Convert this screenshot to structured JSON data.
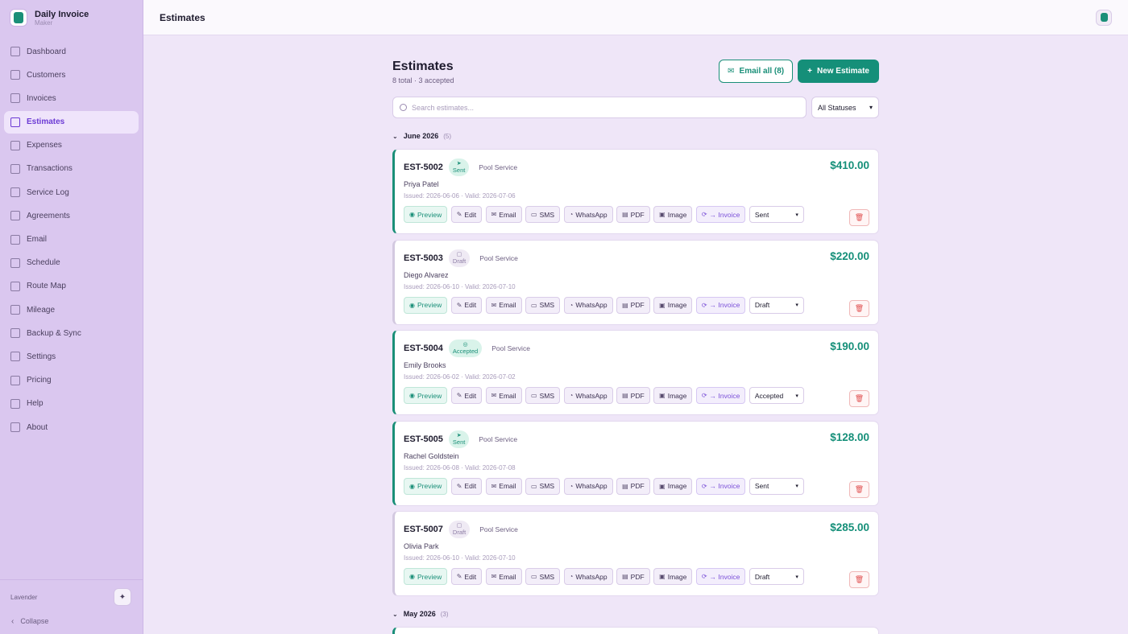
{
  "brand": {
    "title": "Daily Invoice",
    "subtitle": "Maker"
  },
  "sidebar": {
    "items": [
      {
        "label": "Dashboard",
        "icon": "dashboard-icon",
        "active": false
      },
      {
        "label": "Customers",
        "icon": "users-icon",
        "active": false
      },
      {
        "label": "Invoices",
        "icon": "invoice-icon",
        "active": false
      },
      {
        "label": "Estimates",
        "icon": "estimate-icon",
        "active": true
      },
      {
        "label": "Expenses",
        "icon": "receipt-icon",
        "active": false
      },
      {
        "label": "Transactions",
        "icon": "card-icon",
        "active": false
      },
      {
        "label": "Service Log",
        "icon": "clipboard-icon",
        "active": false
      },
      {
        "label": "Agreements",
        "icon": "document-edit-icon",
        "active": false
      },
      {
        "label": "Email",
        "icon": "mail-icon",
        "active": false
      },
      {
        "label": "Schedule",
        "icon": "calendar-icon",
        "active": false
      },
      {
        "label": "Route Map",
        "icon": "map-icon",
        "active": false
      },
      {
        "label": "Mileage",
        "icon": "pin-icon",
        "active": false
      },
      {
        "label": "Backup & Sync",
        "icon": "cloud-icon",
        "active": false
      },
      {
        "label": "Settings",
        "icon": "gear-icon",
        "active": false
      },
      {
        "label": "Pricing",
        "icon": "crown-icon",
        "active": false
      },
      {
        "label": "Help",
        "icon": "book-icon",
        "active": false
      },
      {
        "label": "About",
        "icon": "info-icon",
        "active": false
      }
    ],
    "theme_label": "Lavender",
    "collapse_label": "Collapse"
  },
  "header": {
    "title": "Estimates"
  },
  "page": {
    "title": "Estimates",
    "subtitle": "8 total · 3 accepted",
    "email_all_label": "Email all (8)",
    "new_estimate_label": "New Estimate",
    "search_placeholder": "Search estimates...",
    "status_filter": "All Statuses"
  },
  "action_labels": {
    "preview": "Preview",
    "edit": "Edit",
    "email": "Email",
    "sms": "SMS",
    "whatsapp": "WhatsApp",
    "pdf": "PDF",
    "image": "Image",
    "invoice": "→ Invoice"
  },
  "groups": [
    {
      "label": "June 2026",
      "count": "(5)",
      "estimates": [
        {
          "number": "EST-5002",
          "status": "Sent",
          "service": "Pool Service",
          "customer": "Priya Patel",
          "dates": "Issued: 2026-06-06 · Valid: 2026-07-06",
          "amount": "$410.00",
          "select": "Sent"
        },
        {
          "number": "EST-5003",
          "status": "Draft",
          "service": "Pool Service",
          "customer": "Diego Alvarez",
          "dates": "Issued: 2026-06-10 · Valid: 2026-07-10",
          "amount": "$220.00",
          "select": "Draft"
        },
        {
          "number": "EST-5004",
          "status": "Accepted",
          "service": "Pool Service",
          "customer": "Emily Brooks",
          "dates": "Issued: 2026-06-02 · Valid: 2026-07-02",
          "amount": "$190.00",
          "select": "Accepted"
        },
        {
          "number": "EST-5005",
          "status": "Sent",
          "service": "Pool Service",
          "customer": "Rachel Goldstein",
          "dates": "Issued: 2026-06-08 · Valid: 2026-07-08",
          "amount": "$128.00",
          "select": "Sent"
        },
        {
          "number": "EST-5007",
          "status": "Draft",
          "service": "Pool Service",
          "customer": "Olivia Park",
          "dates": "Issued: 2026-06-10 · Valid: 2026-07-10",
          "amount": "$285.00",
          "select": "Draft"
        }
      ]
    },
    {
      "label": "May 2026",
      "count": "(3)",
      "estimates": []
    }
  ],
  "colors": {
    "accent": "#158f79",
    "sidebar": "#dac7ef",
    "background": "#efe6f8",
    "active": "#6c3bd4"
  }
}
